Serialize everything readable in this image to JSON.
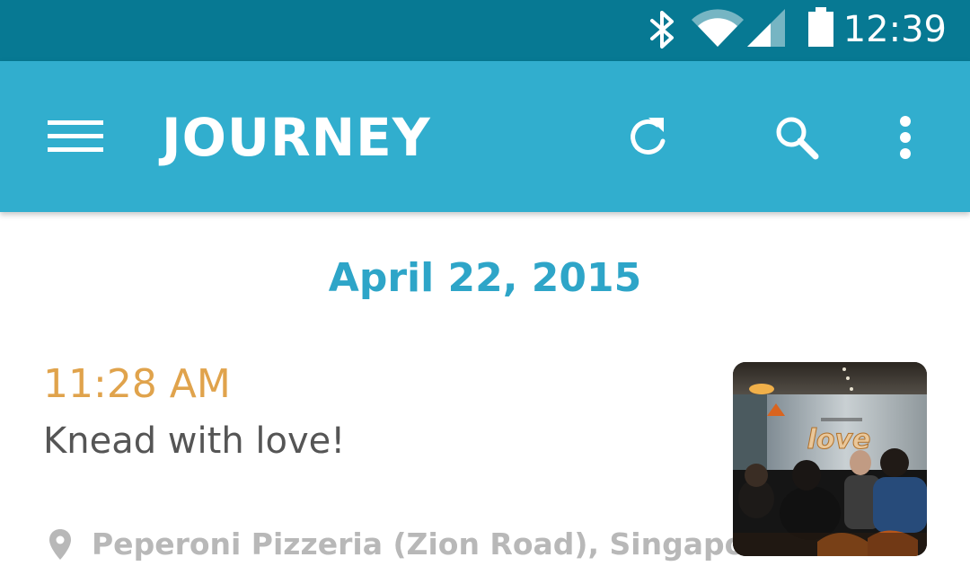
{
  "status_bar": {
    "time": "12:39",
    "icons": [
      "bluetooth-icon",
      "wifi-icon",
      "cell-signal-icon",
      "battery-icon"
    ]
  },
  "app_bar": {
    "title": "JOURNEY",
    "icons": [
      "menu-icon",
      "sync-icon",
      "search-icon",
      "more-vert-icon"
    ]
  },
  "feed": {
    "date": "April 22, 2015",
    "entries": [
      {
        "time": "11:28 AM",
        "text": "Knead with love!",
        "location": "Peperoni Pizzeria (Zion Road), Singapore",
        "photo_sign": "love"
      }
    ]
  },
  "colors": {
    "status_bar": "#077993",
    "app_bar": "#31aece",
    "date": "#2ea5c8",
    "time": "#e0a34c",
    "body_text": "#555555",
    "location": "#b8b8b8"
  }
}
